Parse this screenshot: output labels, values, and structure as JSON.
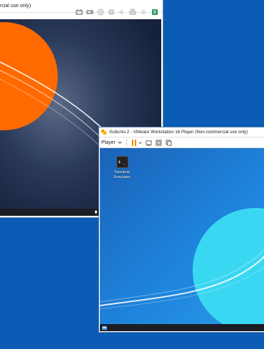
{
  "window1": {
    "title": "rcial use only)"
  },
  "window2": {
    "title": "Xubuntu 2 - VMware Workstation 16 Player (Non-commercial use only)",
    "player_menu": "Player",
    "desktop_icon_label_line1": "Terminal",
    "desktop_icon_label_line2": "Emulator",
    "terminal_glyph": "$ _"
  },
  "colors": {
    "desktop_bg": "#0a5cb4",
    "guest1_bg": "#1d2a45",
    "guest1_sun": "#ff6a00",
    "guest2_bg": "#1c79d6",
    "guest2_sun": "#3ad7f2",
    "pause_orange": "#f08a00",
    "taskbar": "#1b1d22"
  }
}
